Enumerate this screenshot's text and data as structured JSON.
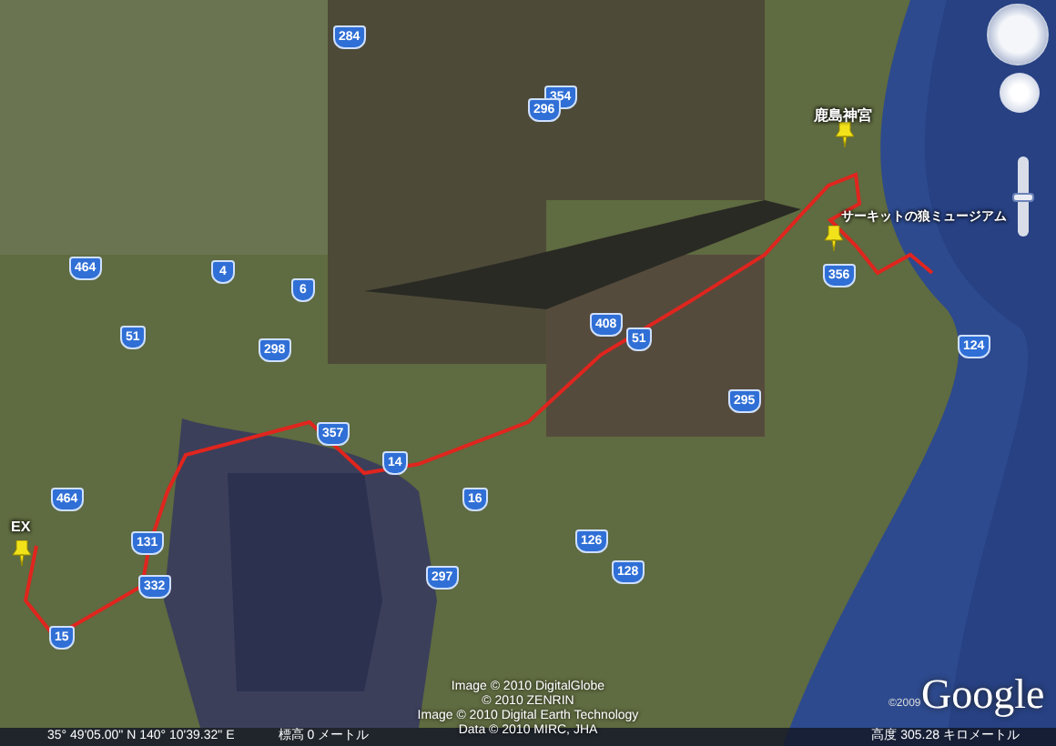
{
  "placemarks": [
    {
      "label": "鹿島神宮"
    },
    {
      "label": "サーキットの狼ミュージアム"
    },
    {
      "label": "EX"
    }
  ],
  "road_shields": [
    "284",
    "354",
    "296",
    "464",
    "4",
    "6",
    "51",
    "298",
    "356",
    "124",
    "408",
    "51",
    "295",
    "357",
    "14",
    "16",
    "126",
    "128",
    "297",
    "464",
    "131",
    "332",
    "15"
  ],
  "attribution": [
    "Image © 2010 DigitalGlobe",
    "© 2010 ZENRIN",
    "Image © 2010 Digital Earth Technology",
    "Data © 2010 MIRC, JHA"
  ],
  "logo_copyright": "©2009",
  "logo": "Google",
  "zoom": {
    "level": 0.5
  },
  "status_bar": {
    "coordinates": "35° 49'05.00\" N  140° 10'39.32\" E",
    "elevation": "標高 0 メートル",
    "eye_altitude": "高度 305.28 キロメートル"
  }
}
